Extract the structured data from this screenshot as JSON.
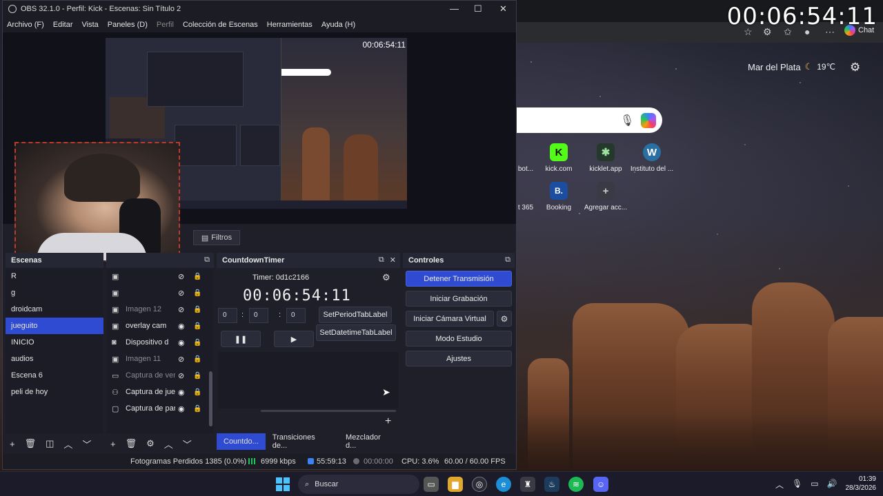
{
  "desktop": {
    "big_clock": "00:06:54:11",
    "weather": {
      "city": "Mar del Plata",
      "icon": "moon-icon",
      "temp": "19℃"
    },
    "browser": {
      "chat_label": "Chat"
    },
    "tiles": [
      {
        "label": "bot...",
        "icon": "app-icon",
        "color": "#2f3e46"
      },
      {
        "label": "kick.com",
        "icon": "kick-icon",
        "color": "#53fc18"
      },
      {
        "label": "kicklet.app",
        "icon": "kicklet-icon",
        "color": "#24382b"
      },
      {
        "label": "Instituto del ...",
        "icon": "wordpress-icon",
        "color": "#2a6fa3"
      },
      {
        "label": "t 365",
        "icon": "app-icon",
        "color": "#2d3b33"
      },
      {
        "label": "Booking",
        "icon": "booking-icon",
        "color": "#1b4ea1"
      },
      {
        "label": "Agregar acc...",
        "icon": "plus-icon",
        "color": "#3a3a44"
      }
    ]
  },
  "obs": {
    "title": "OBS 32.1.0 - Perfil: Kick - Escenas: Sin Título 2",
    "menu": [
      "Archivo (F)",
      "Editar",
      "Vista",
      "Paneles (D)",
      "Perfil",
      "Colección de Escenas",
      "Herramientas",
      "Ayuda (H)"
    ],
    "preview_clock": "00:06:54:11",
    "filters_label": "Filtros",
    "scenes": {
      "title": "Escenas",
      "items": [
        "R",
        "g",
        "droidcam",
        "jueguito",
        "INICIO",
        "audios",
        "Escena 6",
        "peli de hoy"
      ],
      "active_index": 3
    },
    "sources": {
      "items": [
        {
          "name": "",
          "icon": "image-icon",
          "visible": false
        },
        {
          "name": "",
          "icon": "image-icon",
          "visible": false
        },
        {
          "name": "Imagen 12",
          "icon": "image-icon",
          "visible": false
        },
        {
          "name": "overlay cam",
          "icon": "image-icon",
          "visible": true
        },
        {
          "name": "Dispositivo d",
          "icon": "camera-icon",
          "visible": true
        },
        {
          "name": "Imagen 11",
          "icon": "image-icon",
          "visible": false
        },
        {
          "name": "Captura de ven",
          "icon": "window-capture-icon",
          "visible": false
        },
        {
          "name": "Captura de jueg",
          "icon": "game-capture-icon",
          "visible": true
        },
        {
          "name": "Captura de par",
          "icon": "display-capture-icon",
          "visible": true
        }
      ]
    },
    "timer": {
      "title": "CountdownTimer",
      "label": "Timer: 0d1c2166",
      "display": "00:06:54:11",
      "inputs": [
        "0",
        "0",
        "0"
      ],
      "period_btn": "SetPeriodTabLabel",
      "datetime_btn": "SetDatetimeTabLabel"
    },
    "controls": {
      "title": "Controles",
      "stop_stream": "Detener Transmisión",
      "start_record": "Iniciar Grabación",
      "virtual_cam": "Iniciar Cámara Virtual",
      "studio_mode": "Modo Estudio",
      "settings": "Ajustes"
    },
    "dock_tabs": [
      "Countdo...",
      "Transiciones de...",
      "Mezclador d..."
    ],
    "status": {
      "dropped": "Fotogramas Perdidos 1385 (0.0%)",
      "bitrate": "6999 kbps",
      "stream_time": "55:59:13",
      "rec_time": "00:00:00",
      "cpu": "CPU: 3.6%",
      "fps": "60.00 / 60.00 FPS"
    }
  },
  "taskbar": {
    "search_placeholder": "Buscar",
    "time": "01:39",
    "date": "28/3/2026"
  }
}
